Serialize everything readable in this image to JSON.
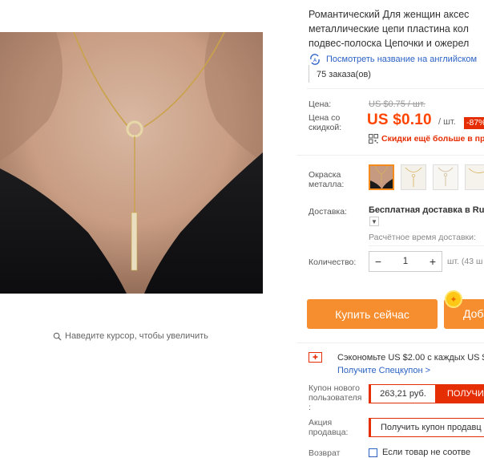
{
  "gallery": {
    "zoom_hint": "Наведите курсор, чтобы увеличить",
    "zoom_icon": "search-icon"
  },
  "product": {
    "title_lines": [
      "Романтический Для женщин аксес",
      "металлические цепи пластина кол",
      "подвес-полоска Цепочки и ожерел"
    ],
    "translate_link": "Посмотреть название на английском",
    "orders": "75 заказа(ов)"
  },
  "price": {
    "price_label": "Цена:",
    "old_price": "US $0.75 / шт.",
    "discount_label": "Цена со скидкой:",
    "new_price": "US $0.10",
    "unit": "/ шт.",
    "discount_badge": "-87%",
    "app_discount": "Скидки ещё больше в пр"
  },
  "options": {
    "color_label": "Окраска металла:",
    "swatches": [
      {
        "name": "gold-on-skin",
        "selected": true
      },
      {
        "name": "gold-on-white",
        "selected": false
      },
      {
        "name": "silver-on-white",
        "selected": false
      },
      {
        "name": "partial",
        "selected": false
      }
    ]
  },
  "shipping": {
    "label": "Доставка:",
    "title": "Бесплатная доставка в Ru",
    "eta": "Расчётное время доставки:"
  },
  "quantity": {
    "label": "Количество:",
    "minus": "−",
    "value": "1",
    "plus": "+",
    "stock": "шт. (43 ш"
  },
  "actions": {
    "buy_now": "Купить сейчас",
    "add_to_cart": "Доба"
  },
  "coupons": {
    "save_text": "Сэкономьте US $2.00 с каждых US $",
    "get_coupon": "Получите Спецкупон >",
    "new_user_label": "Купон нового пользователя :",
    "new_user_value": "263,21 руб.",
    "new_user_get": "ПОЛУЧИ",
    "seller_promo_label": "Акция продавца:",
    "seller_promo_text": "Получить купон продавц"
  },
  "returns": {
    "label": "Возврат",
    "text": "Если товар не соотве"
  },
  "colors": {
    "accent_orange": "#f68d2e",
    "price_red": "#ff4400",
    "coupon_red": "#e62e04",
    "link_blue": "#2b62c4"
  }
}
